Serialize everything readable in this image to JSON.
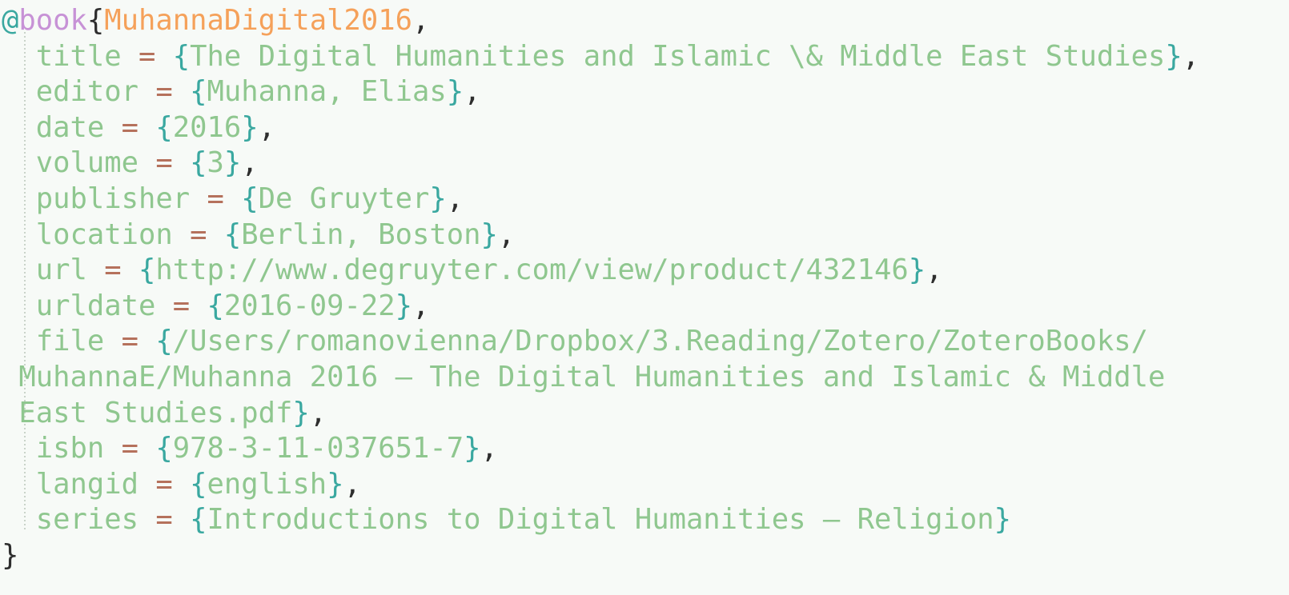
{
  "editor": {
    "language": "bibtex",
    "background_color": "#f7faf7",
    "font_size_px": 35,
    "indent_guide": true
  },
  "colors": {
    "sigil": "#3aa8a0",
    "entry_type": "#c792d6",
    "citation_key": "#f5a15a",
    "field_name": "#8fc78f",
    "equals": "#b5715c",
    "value_brace": "#3aa8a0",
    "value_text": "#8fc78f",
    "punctuation": "#2e2e2e",
    "indent_guide": "#c9d3c9"
  },
  "entry": {
    "sigil": "@",
    "type": "book",
    "open_brace": "{",
    "citation_key": "MuhannaDigital2016",
    "key_comma": ",",
    "close_brace": "}",
    "equals": "=",
    "value_open": "{",
    "value_close": "}",
    "comma": ","
  },
  "fields": [
    {
      "name": "title",
      "value": "The Digital Humanities and Islamic \\& Middle East Studies",
      "trailing_comma": true,
      "wrapped": false
    },
    {
      "name": "editor",
      "value": "Muhanna, Elias",
      "trailing_comma": true,
      "wrapped": false
    },
    {
      "name": "date",
      "value": "2016",
      "trailing_comma": true,
      "wrapped": false
    },
    {
      "name": "volume",
      "value": "3",
      "trailing_comma": true,
      "wrapped": false
    },
    {
      "name": "publisher",
      "value": "De Gruyter",
      "trailing_comma": true,
      "wrapped": false
    },
    {
      "name": "location",
      "value": "Berlin, Boston",
      "trailing_comma": true,
      "wrapped": false
    },
    {
      "name": "url",
      "value": "http://www.degruyter.com/view/product/432146",
      "trailing_comma": true,
      "wrapped": false
    },
    {
      "name": "urldate",
      "value": "2016-09-22",
      "trailing_comma": true,
      "wrapped": false
    },
    {
      "name": "file",
      "value": "/Users/romanovienna/Dropbox/3.Reading/Zotero/ZoteroBooks/MuhannaE/Muhanna 2016 – The Digital Humanities and Islamic & Middle East Studies.pdf",
      "trailing_comma": true,
      "wrapped": true,
      "wrapped_segments": [
        "/Users/romanovienna/Dropbox/3.Reading/Zotero/ZoteroBooks/",
        "MuhannaE/Muhanna 2016 – The Digital Humanities and Islamic & Middle",
        "East Studies.pdf"
      ]
    },
    {
      "name": "isbn",
      "value": "978-3-11-037651-7",
      "trailing_comma": true,
      "wrapped": false
    },
    {
      "name": "langid",
      "value": "english",
      "trailing_comma": true,
      "wrapped": false
    },
    {
      "name": "series",
      "value": "Introductions to Digital Humanities – Religion",
      "trailing_comma": false,
      "wrapped": false
    }
  ]
}
